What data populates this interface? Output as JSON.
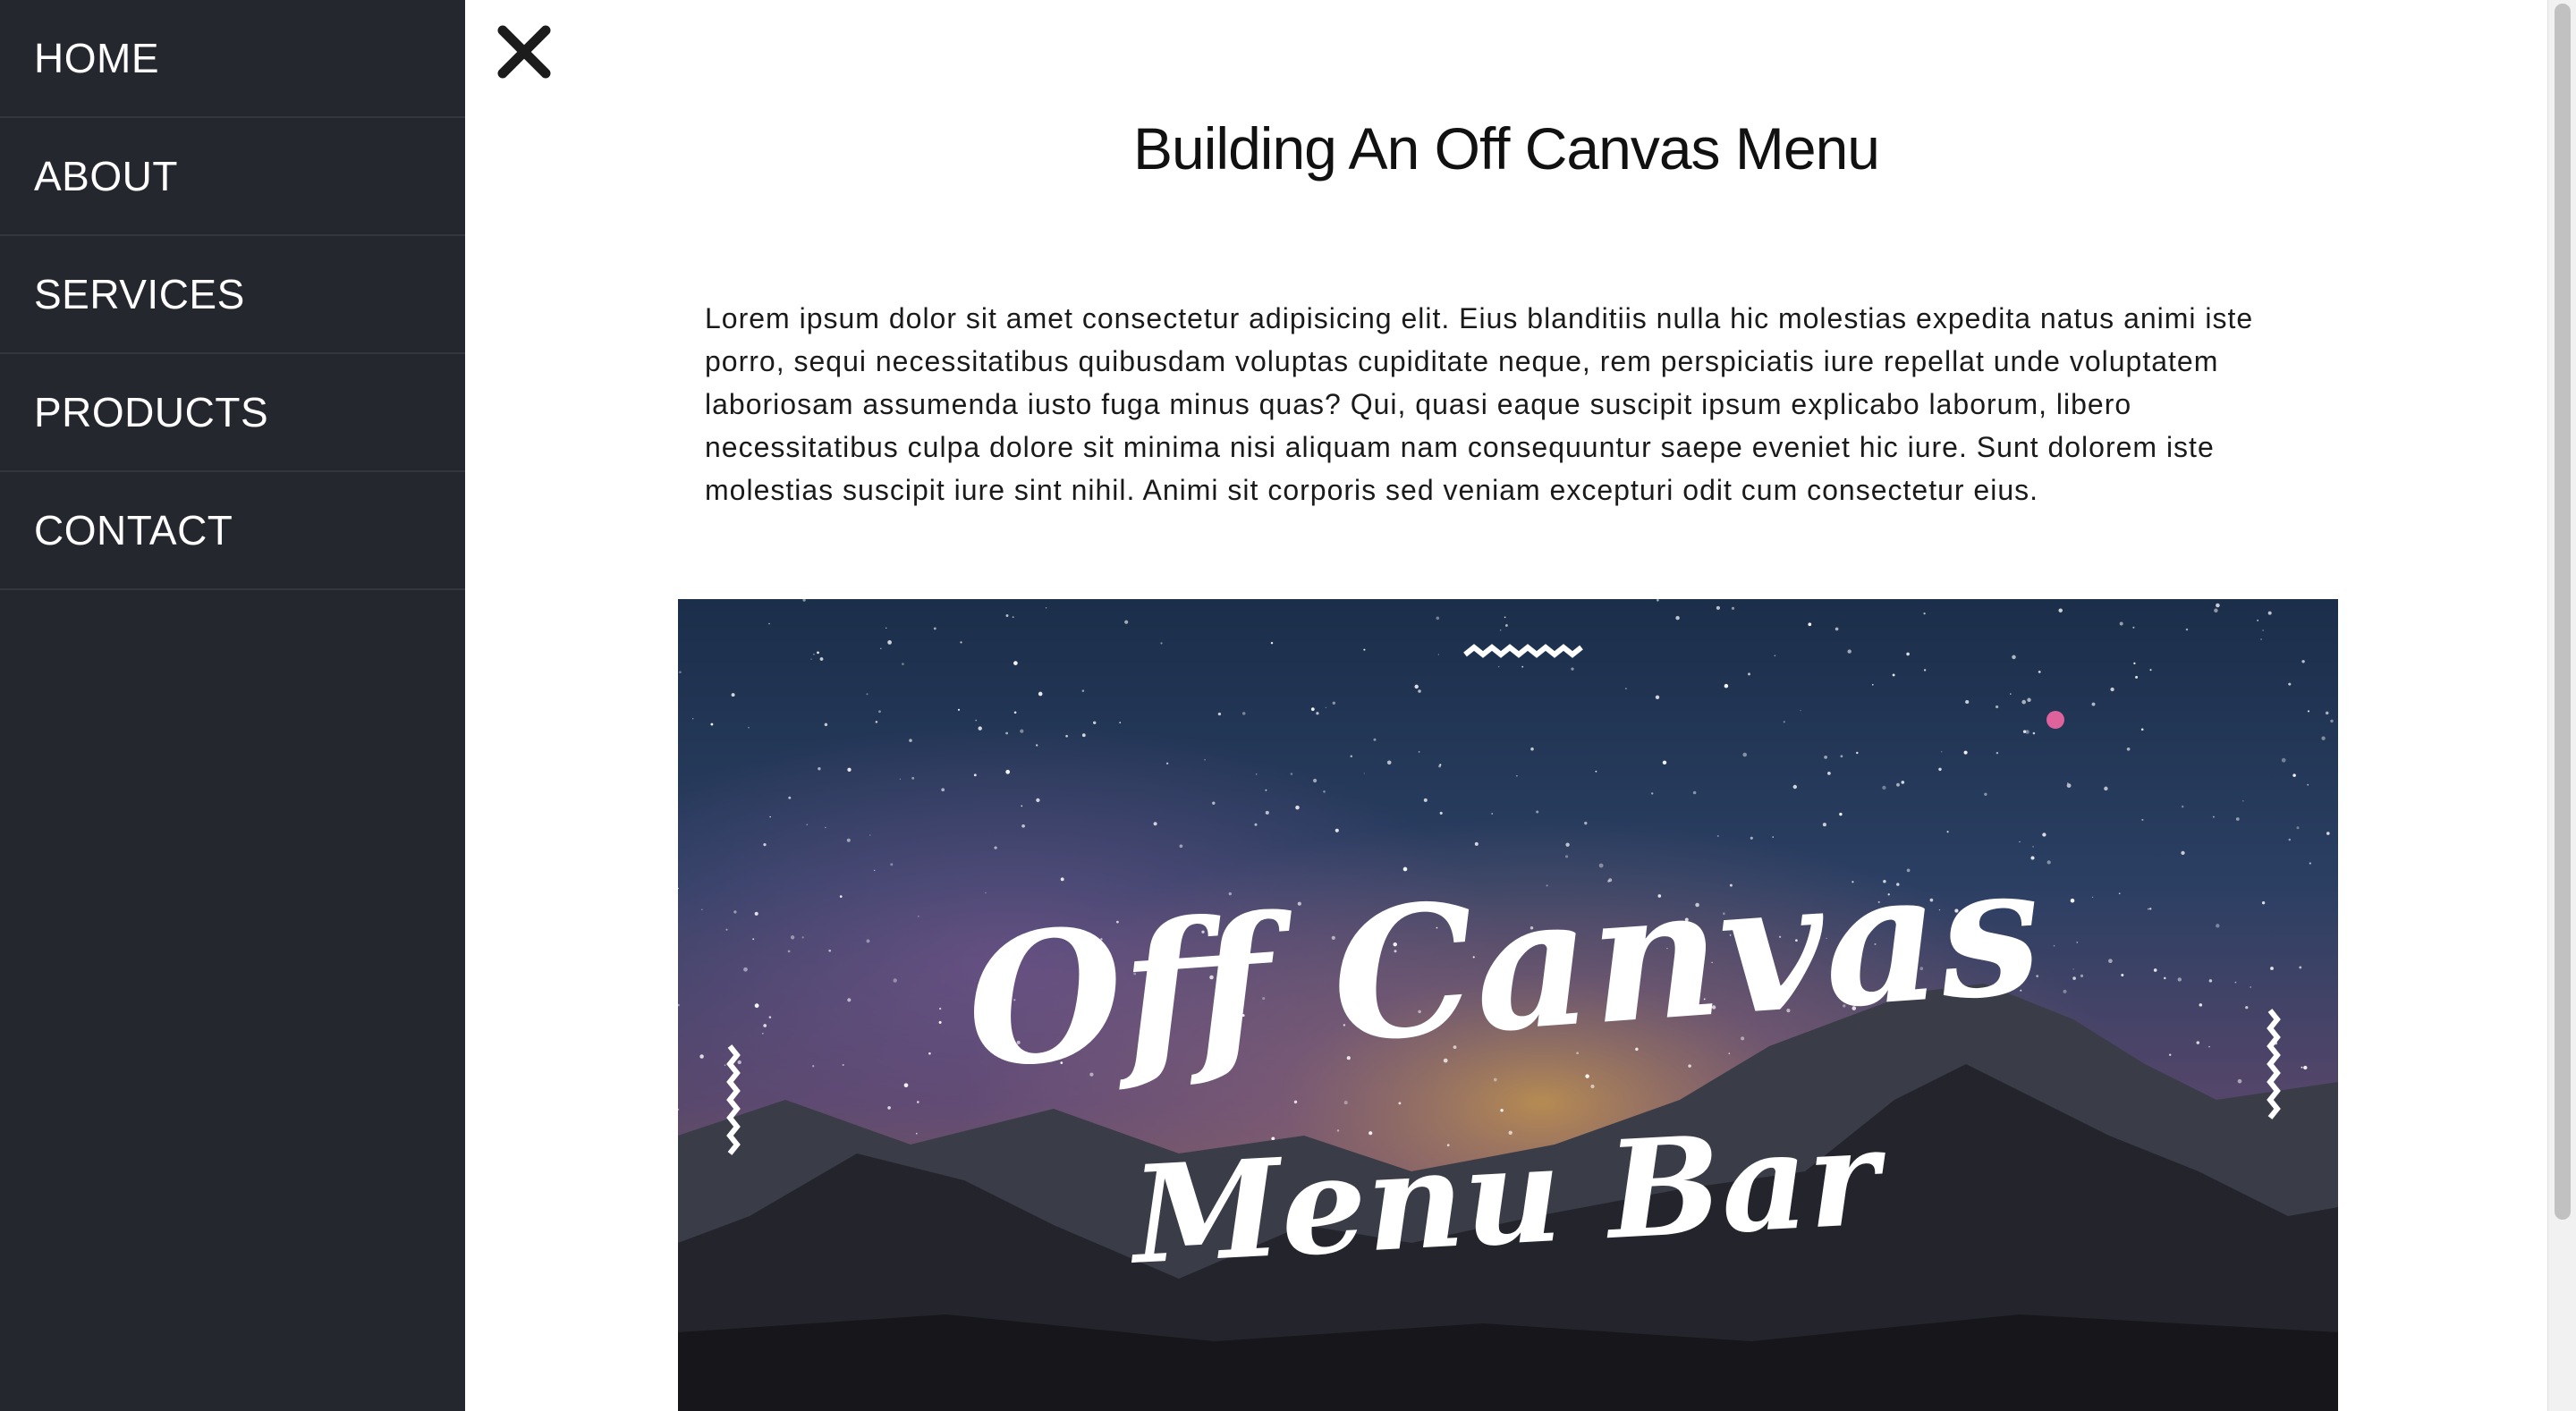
{
  "nav": {
    "items": [
      {
        "label": "HOME"
      },
      {
        "label": "ABOUT"
      },
      {
        "label": "SERVICES"
      },
      {
        "label": "PRODUCTS"
      },
      {
        "label": "CONTACT"
      }
    ]
  },
  "close_icon": "close-icon",
  "main": {
    "title": "Building An Off Canvas Menu",
    "paragraph": "Lorem ipsum dolor sit amet consectetur adipisicing elit. Eius blanditiis nulla hic molestias expedita natus animi iste porro, sequi necessitatibus quibusdam voluptas cupiditate neque, rem perspiciatis iure repellat unde voluptatem laboriosam assumenda iusto fuga minus quas? Qui, quasi eaque suscipit ipsum explicabo laborum, libero necessitatibus culpa dolore sit minima nisi aliquam nam consequuntur saepe eveniet hic iure. Sunt dolorem iste molestias suscipit iure sint nihil. Animi sit corporis sed veniam excepturi odit cum consectetur eius."
  },
  "hero": {
    "title_line1": "Off Canvas",
    "title_line2": "Menu Bar"
  },
  "colors": {
    "sidebar_bg": "#25272e",
    "sidebar_divider": "#33363e",
    "text_dark": "#111111"
  }
}
